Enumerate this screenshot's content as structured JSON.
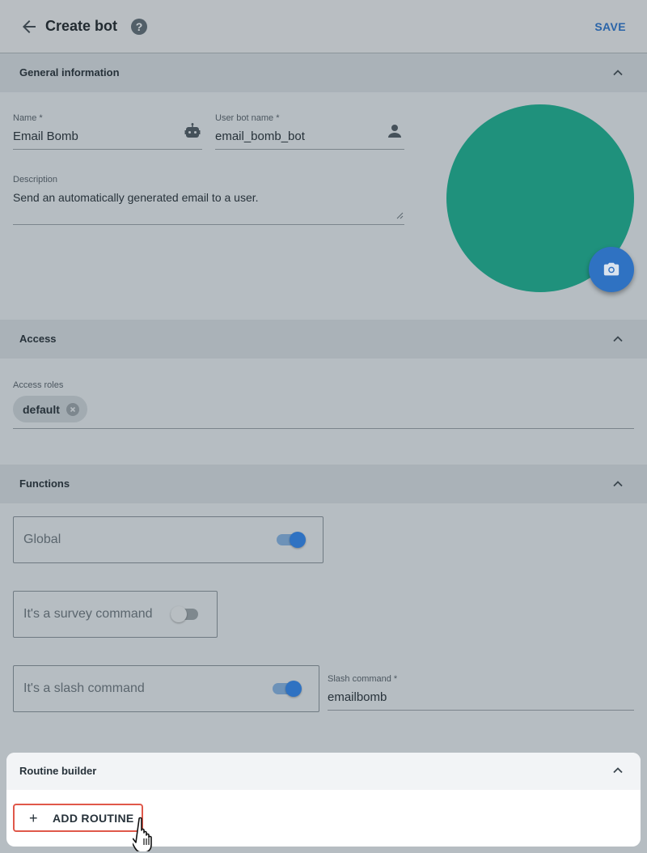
{
  "header": {
    "title": "Create bot",
    "help_icon": "?",
    "save_label": "SAVE"
  },
  "sections": {
    "general": "General information",
    "access": "Access",
    "functions": "Functions",
    "routine": "Routine builder"
  },
  "general": {
    "name_label": "Name *",
    "name_value": "Email Bomb",
    "username_label": "User bot name *",
    "username_value": "email_bomb_bot",
    "description_label": "Description",
    "description_value": "Send an automatically generated email to a user.",
    "avatar_color": "#1f917c"
  },
  "access": {
    "roles_label": "Access roles",
    "chips": [
      "default"
    ]
  },
  "functions": {
    "global_label": "Global",
    "global_on": true,
    "survey_label": "It's a survey command",
    "survey_on": false,
    "slash_label": "It's a slash command",
    "slash_on": true,
    "slash_command_label": "Slash command *",
    "slash_command_value": "emailbomb"
  },
  "routine": {
    "add_plus": "+",
    "add_label": "ADD ROUTINE"
  },
  "colors": {
    "accent": "#2f72c2",
    "highlight_border": "#e0584a"
  }
}
